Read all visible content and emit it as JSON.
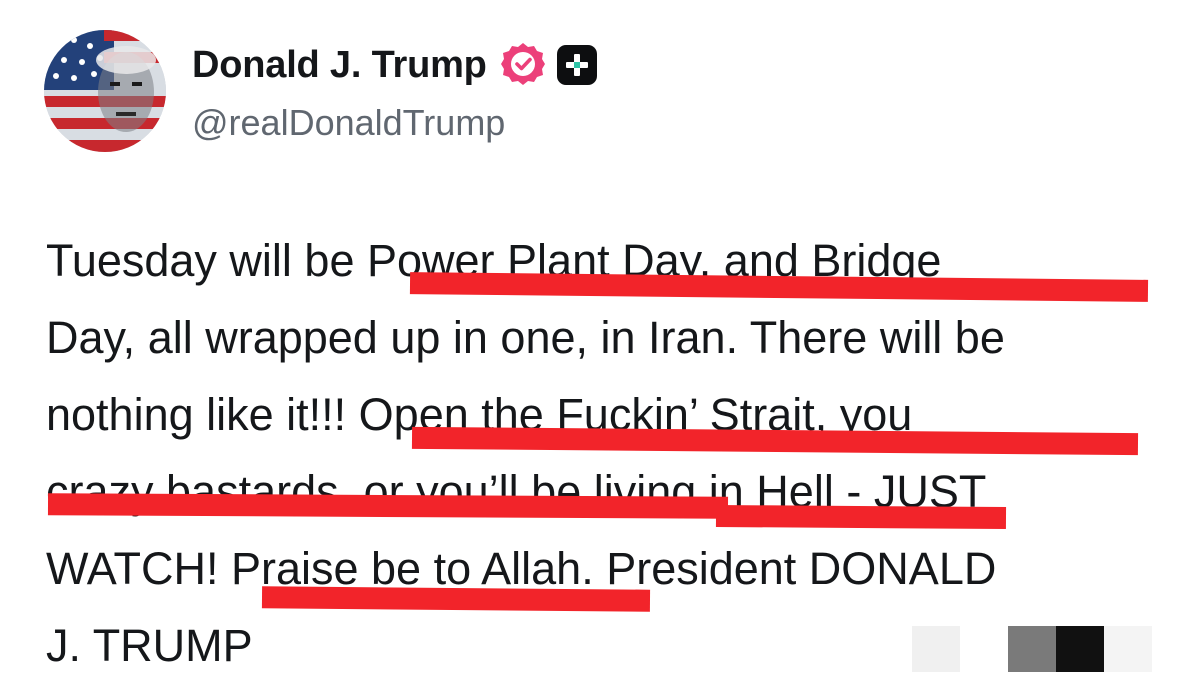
{
  "header": {
    "display_name": "Donald J. Trump",
    "handle": "@realDonaldTrump",
    "verified_icon": "verified-badge-icon",
    "plus_icon": "plus-icon"
  },
  "post": {
    "lines": [
      "Tuesday will be Power Plant Day, and Bridge",
      "Day, all wrapped up in one, in Iran. There will be",
      "nothing like it!!! Open the Fuckin’ Strait, you",
      "crazy bastards, or you’ll be living in Hell - JUST",
      "WATCH! Praise be to Allah. President DONALD",
      "J. TRUMP"
    ]
  },
  "colors": {
    "highlight_underline": "#f2242a",
    "verified": "#ec407a",
    "handle_text": "#606770"
  }
}
